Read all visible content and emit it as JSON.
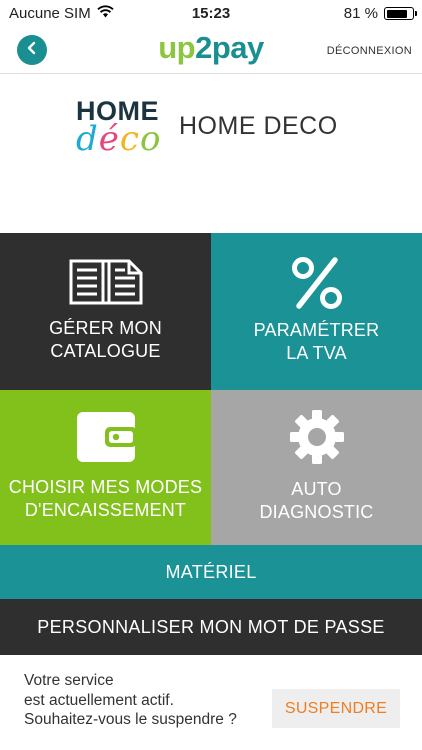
{
  "status_bar": {
    "carrier": "Aucune SIM",
    "time": "15:23",
    "battery_percent": "81 %",
    "battery_level": 0.81,
    "wifi_icon": "wifi-icon"
  },
  "header": {
    "brand_part1": "up",
    "brand_part2": "2pay",
    "logout_label": "DÉCONNEXION",
    "back_icon": "chevron-left-icon",
    "colors": {
      "brand_green": "#8cc63f",
      "brand_teal": "#1a8f91"
    }
  },
  "merchant": {
    "logo_top": "HOME",
    "logo_bottom": "déco",
    "name": "HOME DECO"
  },
  "tiles": [
    {
      "label": "GÉRER MON\nCATALOGUE",
      "icon": "catalog-book-icon",
      "color": "#2f2f2f"
    },
    {
      "label": "PARAMÉTRER\nLA TVA",
      "icon": "percent-icon",
      "color": "#1a9296"
    },
    {
      "label": "CHOISIR MES MODES\nD'ENCAISSEMENT",
      "icon": "wallet-icon",
      "color": "#82c01c"
    },
    {
      "label": "AUTO\nDIAGNOSTIC",
      "icon": "gear-icon",
      "color": "#a6a6a6"
    }
  ],
  "bars": {
    "material_label": "MATÉRIEL",
    "password_label": "PERSONNALISER MON MOT DE PASSE"
  },
  "footer": {
    "line1": "Votre service",
    "line2": "est actuellement actif.",
    "line3": "Souhaitez-vous le suspendre ?",
    "suspend_label": "SUSPENDRE",
    "suspend_color": "#ef7d22"
  }
}
